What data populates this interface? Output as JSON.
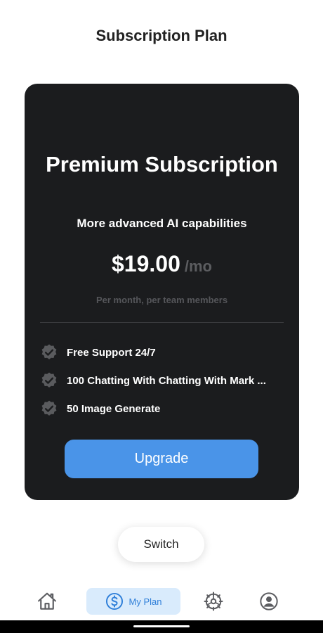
{
  "header": {
    "title": "Subscription Plan"
  },
  "card": {
    "plan_name": "Premium Subscription",
    "subtitle": "More advanced AI capabilities",
    "price": "$19.00",
    "period": "/mo",
    "price_note": "Per month, per team members",
    "features": [
      {
        "label": "Free Support 24/7"
      },
      {
        "label": "100 Chatting With Chatting With Mark ..."
      },
      {
        "label": "50 Image Generate"
      }
    ],
    "upgrade_label": "Upgrade"
  },
  "switch_label": "Switch",
  "nav": {
    "items": [
      {
        "icon": "home-icon"
      },
      {
        "icon": "dollar-icon",
        "label": "My Plan",
        "active": true
      },
      {
        "icon": "gear-icon"
      },
      {
        "icon": "profile-icon"
      }
    ]
  },
  "colors": {
    "card_bg": "#1b1c1e",
    "accent": "#4a94e8",
    "nav_active_bg": "#d9ebfc",
    "nav_active_text": "#2f7fd9"
  }
}
